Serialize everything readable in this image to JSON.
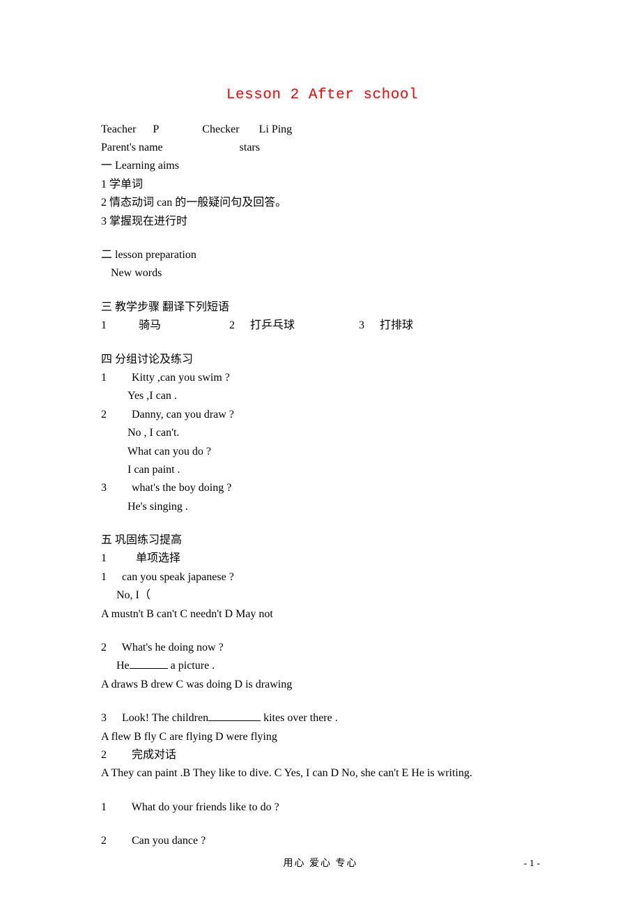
{
  "title": "Lesson 2 After school",
  "meta": {
    "teacher_label": "Teacher",
    "teacher_value": "P",
    "checker_label": "Checker",
    "checker_value": "Li Ping",
    "parent_label": "Parent's  name",
    "stars_label": "stars"
  },
  "section1": {
    "heading": "一  Learning aims",
    "items": {
      "a": "1  学单词",
      "b": "2  情态动词 can  的一般疑问句及回答。",
      "c": "3  掌握现在进行时"
    }
  },
  "section2": {
    "heading": "二  lesson preparation",
    "sub": "New words"
  },
  "section3": {
    "heading": "三  教学步骤  翻译下列短语",
    "row": {
      "n1": "1",
      "t1": "骑马",
      "n2": "2",
      "t2": "打乒乓球",
      "n3": "3",
      "t3": "打排球"
    }
  },
  "section4": {
    "heading": "四    分组讨论及练习",
    "q1n": "1",
    "q1a": "Kitty ,can you  swim ?",
    "q1b": "Yes ,I can .",
    "q2n": "2",
    "q2a": "Danny, can you draw ?",
    "q2b": "No , I  can't.",
    "q2c": "What can you do ?",
    "q2d": "I can paint .",
    "q3n": "3",
    "q3a": "what's the boy doing ?",
    "q3b": "He's singing ."
  },
  "section5": {
    "heading": "五    巩固练习提高",
    "sub1n": "1",
    "sub1": "单项选择",
    "mc1": {
      "n": "1",
      "q": "can you speak japanese    ?",
      "stem": "No, I（",
      "opts": "A   mustn't     B   can't      C   needn't         D   May    not"
    },
    "mc2": {
      "n": "2",
      "q": "What's he  doing now ?",
      "stem_a": "He",
      "stem_b": "a picture    .",
      "opts": "A    draws      B     drew     C    was   doing     D      is     drawing"
    },
    "mc3": {
      "n": "3",
      "q_a": "Look! The children",
      "q_b": "kites over there .",
      "opts": "A     flew       B    fly      C   are   flying      D      were   flying"
    },
    "sub2n": "2",
    "sub2": "完成对话",
    "bank": "A   They  can  paint   .B  They  like  to  dive.    C   Yes,  I  can   D   No,  she  can't    E    He  is writing.",
    "dq1n": "1",
    "dq1": "What do your friends like to do ?",
    "dq2n": "2",
    "dq2": "Can you dance ?"
  },
  "footer": {
    "text": "用心      爱心      专心",
    "page": "- 1 -"
  }
}
